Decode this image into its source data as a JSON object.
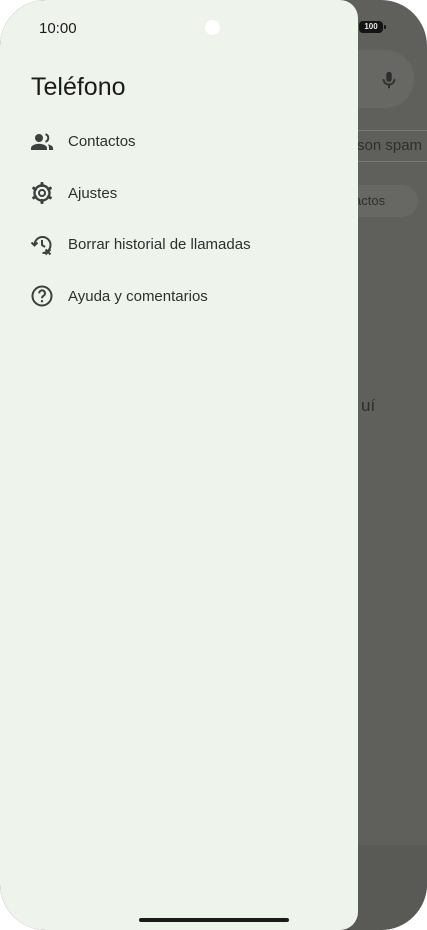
{
  "status_bar": {
    "time": "10:00",
    "battery": "100"
  },
  "drawer": {
    "title": "Teléfono",
    "items": [
      {
        "label": "Contactos",
        "icon": "contacts-icon"
      },
      {
        "label": "Ajustes",
        "icon": "settings-gear-icon"
      },
      {
        "label": "Borrar historial de llamadas",
        "icon": "clear-history-icon"
      },
      {
        "label": "Ayuda y comentarios",
        "icon": "help-icon"
      }
    ]
  },
  "background": {
    "chip_spam": "son spam",
    "chip_contacts": "actos",
    "partial_text": "uí"
  },
  "colors": {
    "drawer_bg": "#eef3ec",
    "scrim": "#5f605c",
    "text": "#1b1c1a"
  }
}
